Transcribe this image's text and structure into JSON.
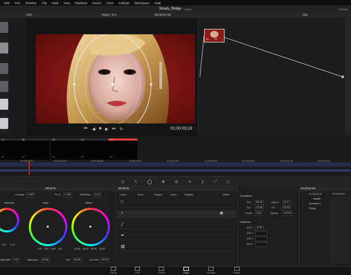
{
  "menubar": {
    "items": [
      "Edit",
      "Trim",
      "Timeline",
      "Clip",
      "Mark",
      "View",
      "Playback",
      "Fusion",
      "Color",
      "Fairlight",
      "Workspace",
      "Help"
    ]
  },
  "titlebar": {
    "project": "Simply_Bridge",
    "status": "Edited",
    "right_label": "Timeline"
  },
  "toolbar": {
    "zoom": "16%",
    "timeline_name": "Steps_TL1",
    "timecode": "00:00:01:04",
    "mode": "Clip"
  },
  "viewer": {
    "timecode": "01:00:03;19"
  },
  "node": {
    "label": "01",
    "clip_label": "V1"
  },
  "clips": [
    {
      "num": "01",
      "track": "V1"
    },
    {
      "num": "02",
      "track": "V1"
    },
    {
      "num": "03",
      "track": "V1"
    },
    {
      "num": "04",
      "track": "V1"
    },
    {
      "num": "05",
      "track": "V1"
    },
    {
      "num": "07",
      "track": "V1"
    }
  ],
  "ruler_ticks": [
    "01:00:00:00",
    "01:00:03:00",
    "01:00:06:00",
    "01:00:09:00",
    "01:00:12:00",
    "01:00:15:00",
    "01:00:18:00",
    "01:00:21:00",
    "01:00:24:00"
  ],
  "wheels": {
    "title": "Wheels",
    "contrast_label": "Contrast",
    "contrast": "1.000",
    "pivot_label": "Pivot",
    "pivot": "0.435",
    "middetail_label": "Mid/Detail",
    "middetail": "0.00",
    "items": [
      {
        "name": "Gamma",
        "values": [
          "0.00",
          "-0.00",
          "-0.00",
          "-0.00"
        ]
      },
      {
        "name": "Gain",
        "values": [
          "1.00",
          "0.89",
          "0.89",
          "1.00"
        ]
      },
      {
        "name": "Offset",
        "values": [
          "18.26",
          "28.00",
          "28.00",
          "26.00"
        ]
      }
    ],
    "footer": [
      {
        "label": "Highlights",
        "value": "0.00"
      },
      {
        "label": "Saturation",
        "value": "50.00"
      },
      {
        "label": "Hue",
        "value": "50.00"
      },
      {
        "label": "Lum Mix",
        "value": "100.00"
      }
    ]
  },
  "window": {
    "title": "Window",
    "tools": [
      "Linear",
      "Circle",
      "Polygon",
      "Curve",
      "Gradient"
    ],
    "delete_label": "Delete"
  },
  "transform": {
    "title": "Transform",
    "fields": [
      {
        "label": "Size",
        "value": "58.45"
      },
      {
        "label": "Aspect",
        "value": "40.27"
      },
      {
        "label": "Pan",
        "value": "49.38"
      },
      {
        "label": "Tilt",
        "value": "52.83"
      },
      {
        "label": "Rotate",
        "value": "0.00"
      },
      {
        "label": "Opacity",
        "value": "100.00"
      }
    ],
    "softness_title": "Softness",
    "softness": [
      {
        "label": "Soft 1",
        "value": "10.00"
      },
      {
        "label": "Soft 2",
        "value": ""
      },
      {
        "label": "Soft 3",
        "value": ""
      },
      {
        "label": "Soft 4",
        "value": ""
      }
    ]
  },
  "keyframes": {
    "title": "Keyframes",
    "timecode_a": "00:00:01:04",
    "timecode_b": "00:00:00:00",
    "master": "Master",
    "rows": [
      "Corrector 1",
      "Sizing"
    ]
  },
  "pages": [
    "Media",
    "Edit",
    "Fusion",
    "Color",
    "Fairlight",
    "Deliver"
  ],
  "active_page": "Color",
  "colors": {
    "accent": "#e8403c",
    "bg": "#1b1b1d",
    "ruler": "#3a4a8a"
  }
}
